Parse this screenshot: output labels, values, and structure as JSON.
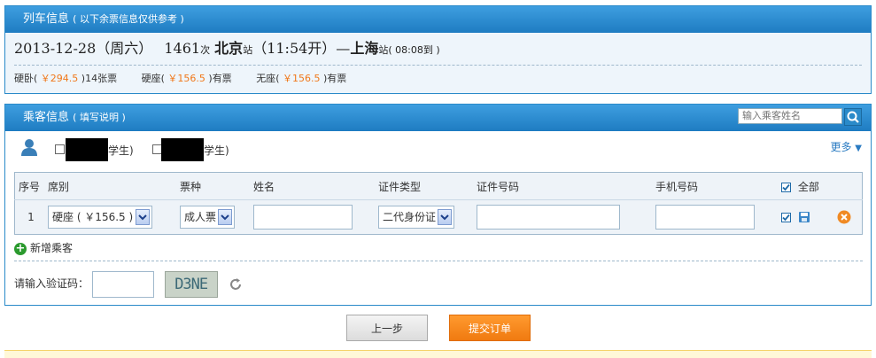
{
  "train_panel": {
    "title": "列车信息",
    "subtitle": "( 以下余票信息仅供参考 )",
    "date": "2013-12-28（周六）",
    "train_no": "1461",
    "train_suffix": "次",
    "from": "北京",
    "from_suffix": "站",
    "depart": "（11:54开）—",
    "to": "上海",
    "to_suffix": "站",
    "arrive": "( 08:08到 )",
    "seats": [
      {
        "name": "硬卧",
        "open": "(",
        "price": "￥294.5",
        "close": ")",
        "avail": "14张票"
      },
      {
        "name": "硬座",
        "open": "(",
        "price": "￥156.5",
        "close": ")",
        "avail": "有票"
      },
      {
        "name": "无座",
        "open": "(",
        "price": "￥156.5",
        "close": ")",
        "avail": "有票"
      }
    ]
  },
  "passenger_panel": {
    "title": "乘客信息",
    "subtitle": "( 填写说明 )",
    "search_placeholder": "输入乘客姓名",
    "contacts": [
      {
        "tag": "学生)"
      },
      {
        "tag": "学生)"
      }
    ],
    "more": "更多",
    "columns": [
      "序号",
      "席别",
      "票种",
      "姓名",
      "证件类型",
      "证件号码",
      "手机号码",
      "全部"
    ],
    "rows": [
      {
        "index": "1",
        "seat": "硬座 ( ￥156.5 )",
        "ticket_type": "成人票",
        "name": "",
        "id_type": "二代身份证",
        "id_no": "",
        "phone": ""
      }
    ],
    "add_passenger": "新增乘客",
    "captcha_label": "请输入验证码：",
    "captcha_text": "D3NE",
    "captcha_value": ""
  },
  "buttons": {
    "prev": "上一步",
    "submit": "提交订单"
  },
  "colors": {
    "header_blue": "#2a8ac9",
    "price_orange": "#f0781a",
    "submit_orange": "#f5821f"
  }
}
